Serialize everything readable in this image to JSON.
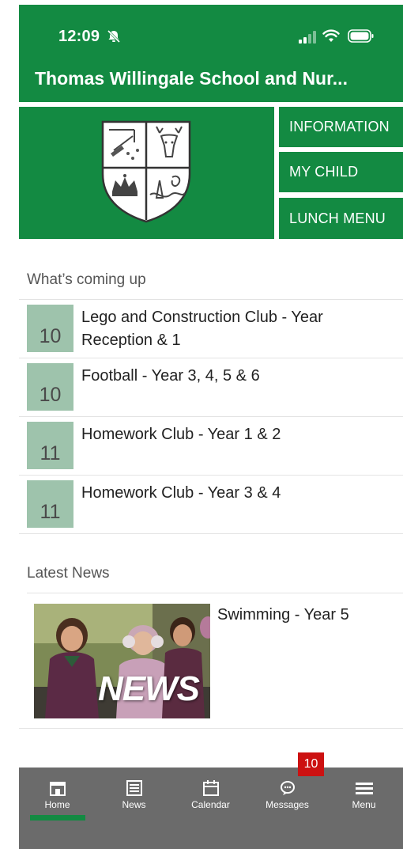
{
  "status_bar": {
    "time": "12:09"
  },
  "header": {
    "title": "Thomas Willingale School and Nur..."
  },
  "hero": {
    "buttons": [
      {
        "label": "INFORMATION"
      },
      {
        "label": "MY CHILD"
      },
      {
        "label": "LUNCH MENU"
      }
    ]
  },
  "events": {
    "title": "What’s coming up",
    "items": [
      {
        "day": "10",
        "title": "Lego and Construction Club - Year Reception & 1"
      },
      {
        "day": "10",
        "title": "Football - Year 3, 4, 5 & 6"
      },
      {
        "day": "11",
        "title": "Homework Club - Year 1 & 2"
      },
      {
        "day": "11",
        "title": "Homework Club - Year 3 & 4"
      }
    ]
  },
  "news": {
    "title": "Latest News",
    "items": [
      {
        "title": "Swimming - Year 5",
        "thumb_text": "NEWS"
      }
    ]
  },
  "tabbar": {
    "tabs": [
      {
        "label": "Home",
        "icon": "home-icon"
      },
      {
        "label": "News",
        "icon": "news-icon"
      },
      {
        "label": "Calendar",
        "icon": "calendar-icon"
      },
      {
        "label": "Messages",
        "icon": "messages-icon"
      },
      {
        "label": "Menu",
        "icon": "menu-icon"
      }
    ],
    "messages_badge": "10",
    "active_tab": "Home"
  },
  "colors": {
    "brand_green": "#138a42",
    "date_box": "#9ec3ac",
    "tabbar_bg": "#6b6b6b",
    "badge_red": "#cc1111"
  }
}
